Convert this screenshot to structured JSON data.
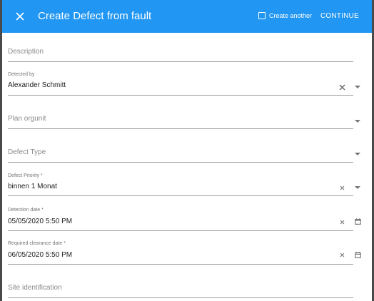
{
  "dialog": {
    "title": "Create Defect from fault",
    "create_another_label": "Create another",
    "continue_label": "CONTINUE"
  },
  "fields": {
    "description": {
      "placeholder": "Description"
    },
    "detected_by": {
      "label": "Detected by",
      "value": "Alexander Schmitt"
    },
    "plan_orgunit": {
      "placeholder": "Plan orgunit"
    },
    "defect_type": {
      "placeholder": "Defect Type"
    },
    "defect_priority": {
      "label": "Defect Priority *",
      "value": "binnen 1 Monat"
    },
    "detection_date": {
      "label": "Detection date *",
      "value": "05/05/2020 5:50 PM"
    },
    "required_clearance_date": {
      "label": "Required clearance date *",
      "value": "06/05/2020 5:50 PM"
    },
    "site_identification": {
      "placeholder": "Site identification"
    }
  },
  "icons": {
    "close": "close-icon",
    "clear": "clear-icon",
    "dropdown": "chevron-down-icon",
    "calendar": "calendar-icon"
  },
  "colors": {
    "header": "#2196f3",
    "underline": "#9e9e9e"
  }
}
